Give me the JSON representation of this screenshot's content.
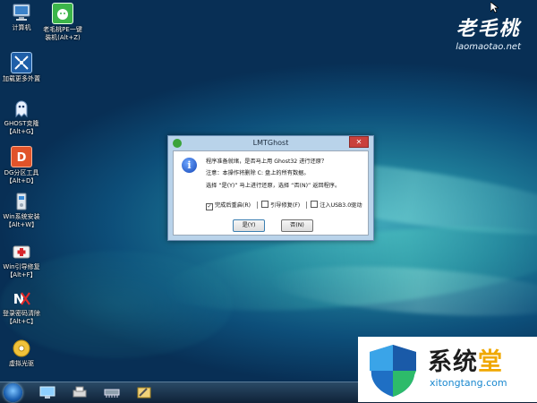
{
  "desktop": {
    "icons": [
      {
        "name": "computer",
        "label": "计算机",
        "label2": ""
      },
      {
        "name": "laomaotao-pe",
        "label": "老毛桃PE一键",
        "label2": "装机(Alt+Z)"
      },
      {
        "name": "load-peripherals",
        "label": "加载更多外置",
        "label2": ""
      },
      {
        "name": "ghost",
        "label": "GHOST克隆",
        "label2": "【Alt+G】"
      },
      {
        "name": "dg-partition",
        "label": "DG分区工具",
        "label2": "【Alt+D】"
      },
      {
        "name": "win-install",
        "label": "Win系统安装",
        "label2": "【Alt+W】"
      },
      {
        "name": "win-boot-repair",
        "label": "Win引导修复",
        "label2": "【Alt+F】"
      },
      {
        "name": "password-clear",
        "label": "登录密码清除",
        "label2": "【Alt+C】"
      },
      {
        "name": "virtual-drive",
        "label": "虚拟光驱",
        "label2": ""
      }
    ]
  },
  "brand": {
    "title": "老毛桃",
    "url": "laomaotao.net"
  },
  "dialog": {
    "title": "LMTGhost",
    "close_label": "✕",
    "line1": "程序准备就绪，是否马上用 Ghost32 进行还原？",
    "line2": "注意：本操作将删除 C: 盘上的所有数据。",
    "line3": "选择 “是(Y)” 马上进行还原，选择 “否(N)” 返回程序。",
    "options": [
      {
        "label": "完成后重启(R)",
        "checked": true
      },
      {
        "label": "引导修复(F)",
        "checked": false
      },
      {
        "label": "注入USB3.0驱动",
        "checked": false
      }
    ],
    "yes_label": "是(Y)",
    "no_label": "否(N)"
  },
  "watermark": {
    "title_main": "系统",
    "title_accent": "堂",
    "url": "xitongtang.com"
  },
  "colors": {
    "dialog_bg": "#b9d3ea",
    "close_red": "#c9413d",
    "watermark_url": "#1a88cf",
    "watermark_accent": "#f0a800"
  }
}
